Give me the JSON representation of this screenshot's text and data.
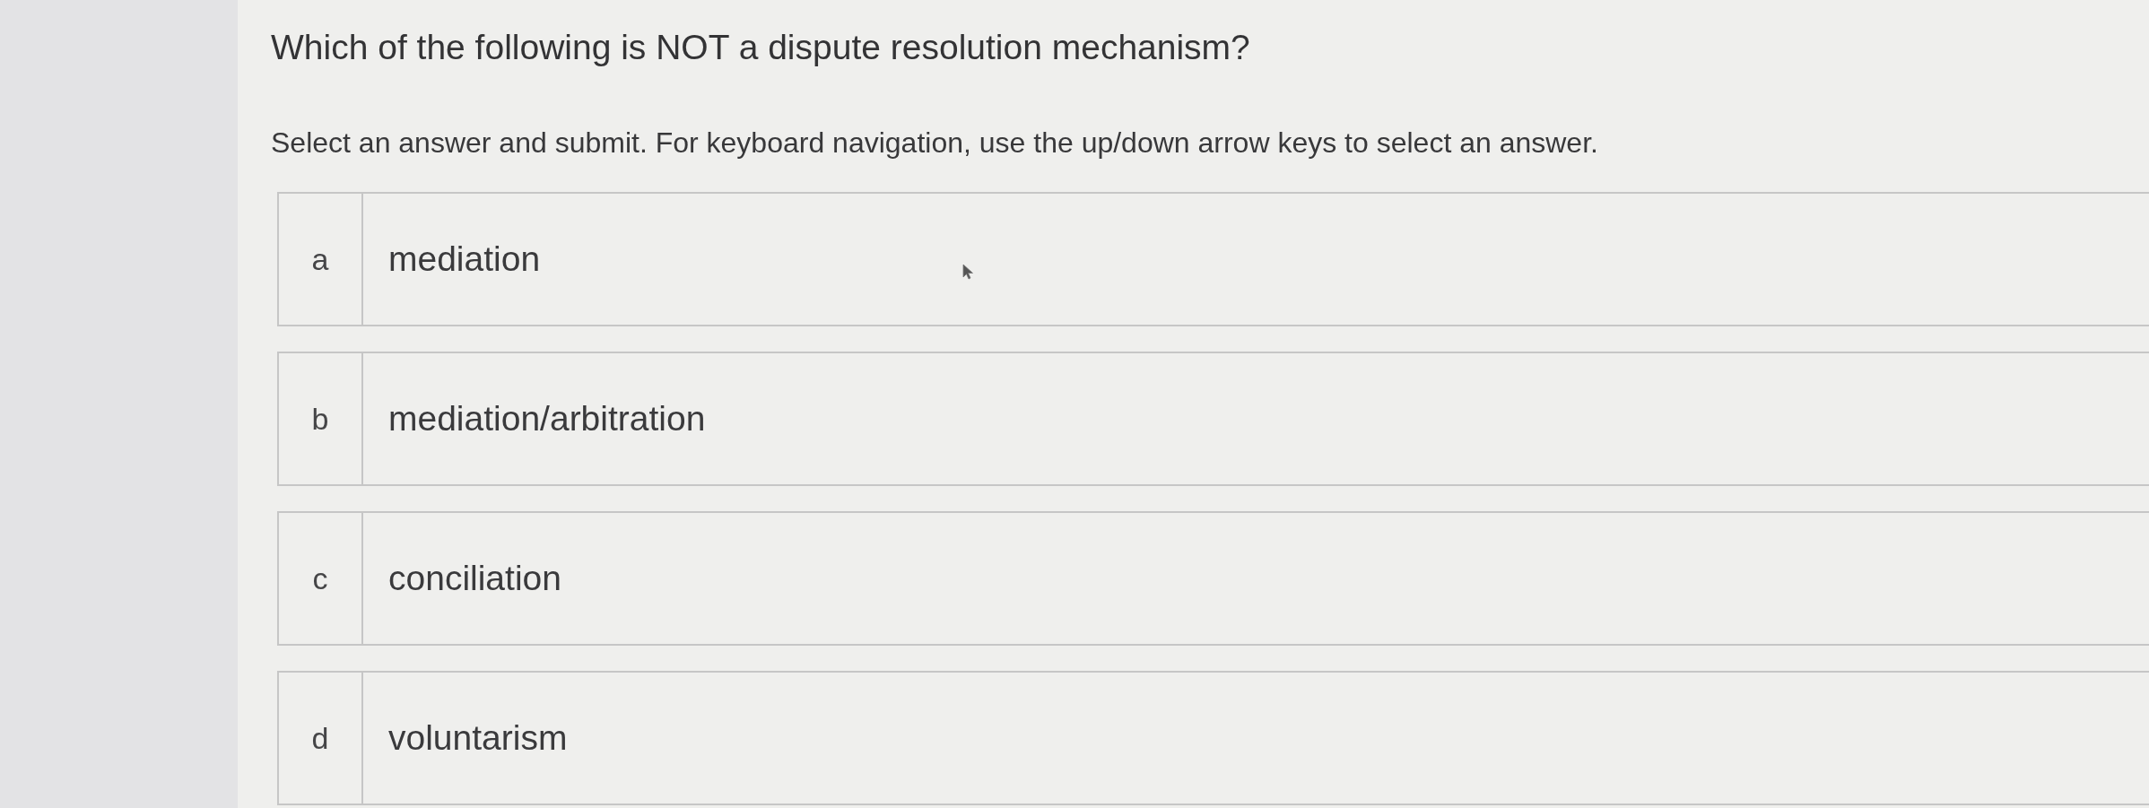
{
  "question": {
    "text": "Which of the following is NOT a dispute resolution mechanism?"
  },
  "instructions": "Select an answer and submit. For keyboard navigation, use the up/down arrow keys to select an answer.",
  "options": [
    {
      "letter": "a",
      "text": "mediation",
      "selected": false
    },
    {
      "letter": "b",
      "text": "mediation/arbitration",
      "selected": false
    },
    {
      "letter": "c",
      "text": "conciliation",
      "selected": false
    },
    {
      "letter": "d",
      "text": "voluntarism",
      "selected": false
    }
  ]
}
